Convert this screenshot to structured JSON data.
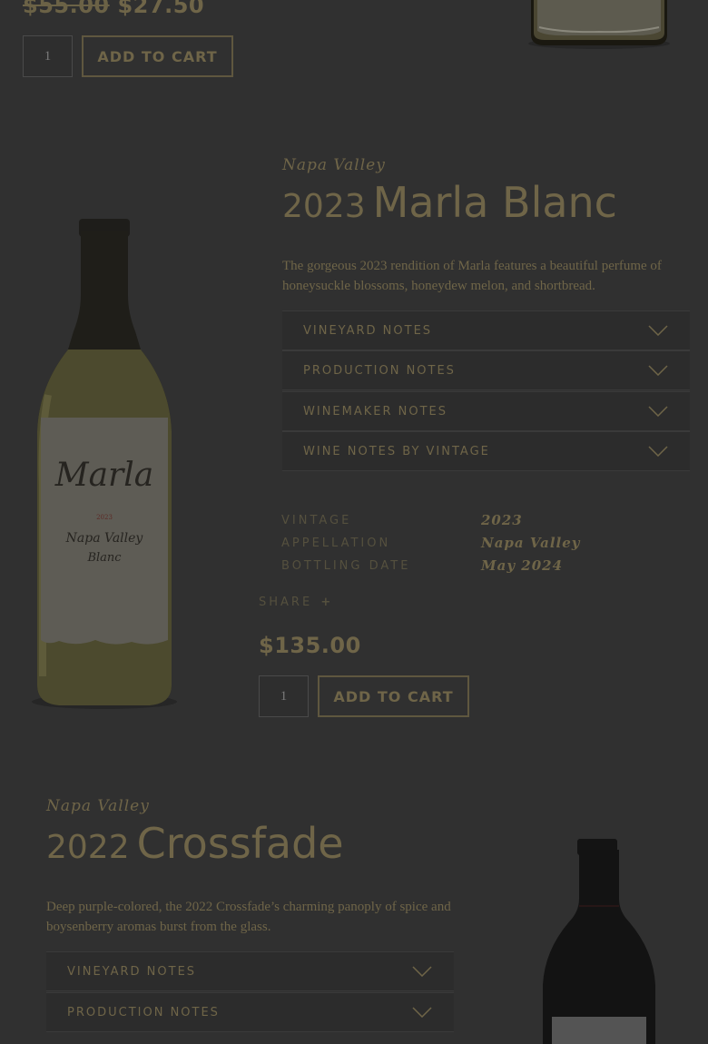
{
  "top_product": {
    "old_price": "$55.00",
    "price": "$27.50",
    "qty": "1",
    "cart_label": "ADD TO CART"
  },
  "marla": {
    "region": "Napa Valley",
    "year": "2023",
    "name": "Marla Blanc",
    "description": "The gorgeous 2023 rendition of Marla features a beautiful perfume of honeysuckle blossoms, honeydew melon, and shortbread.",
    "accordion": [
      "VINEYARD NOTES",
      "PRODUCTION NOTES",
      "WINEMAKER NOTES",
      "WINE NOTES BY VINTAGE"
    ],
    "specs": [
      {
        "label": "VINTAGE",
        "value": "2023"
      },
      {
        "label": "APPELLATION",
        "value": "Napa Valley"
      },
      {
        "label": "BOTTLING DATE",
        "value": "May 2024"
      }
    ],
    "share_label": "SHARE",
    "share_icon": "plus-icon",
    "price": "$135.00",
    "qty": "1",
    "cart_label": "ADD TO CART",
    "label_script": "Marla",
    "label_year": "2023",
    "label_region": "Napa Valley",
    "label_type": "Blanc"
  },
  "crossfade": {
    "region": "Napa Valley",
    "year": "2022",
    "name": "Crossfade",
    "description": "Deep purple-colored, the 2022 Crossfade’s charming panoply of spice and boysenberry aromas burst from the glass.",
    "accordion": [
      "VINEYARD NOTES",
      "PRODUCTION NOTES"
    ]
  },
  "colors": {
    "background": "#303030",
    "accent": "#6f6548"
  }
}
